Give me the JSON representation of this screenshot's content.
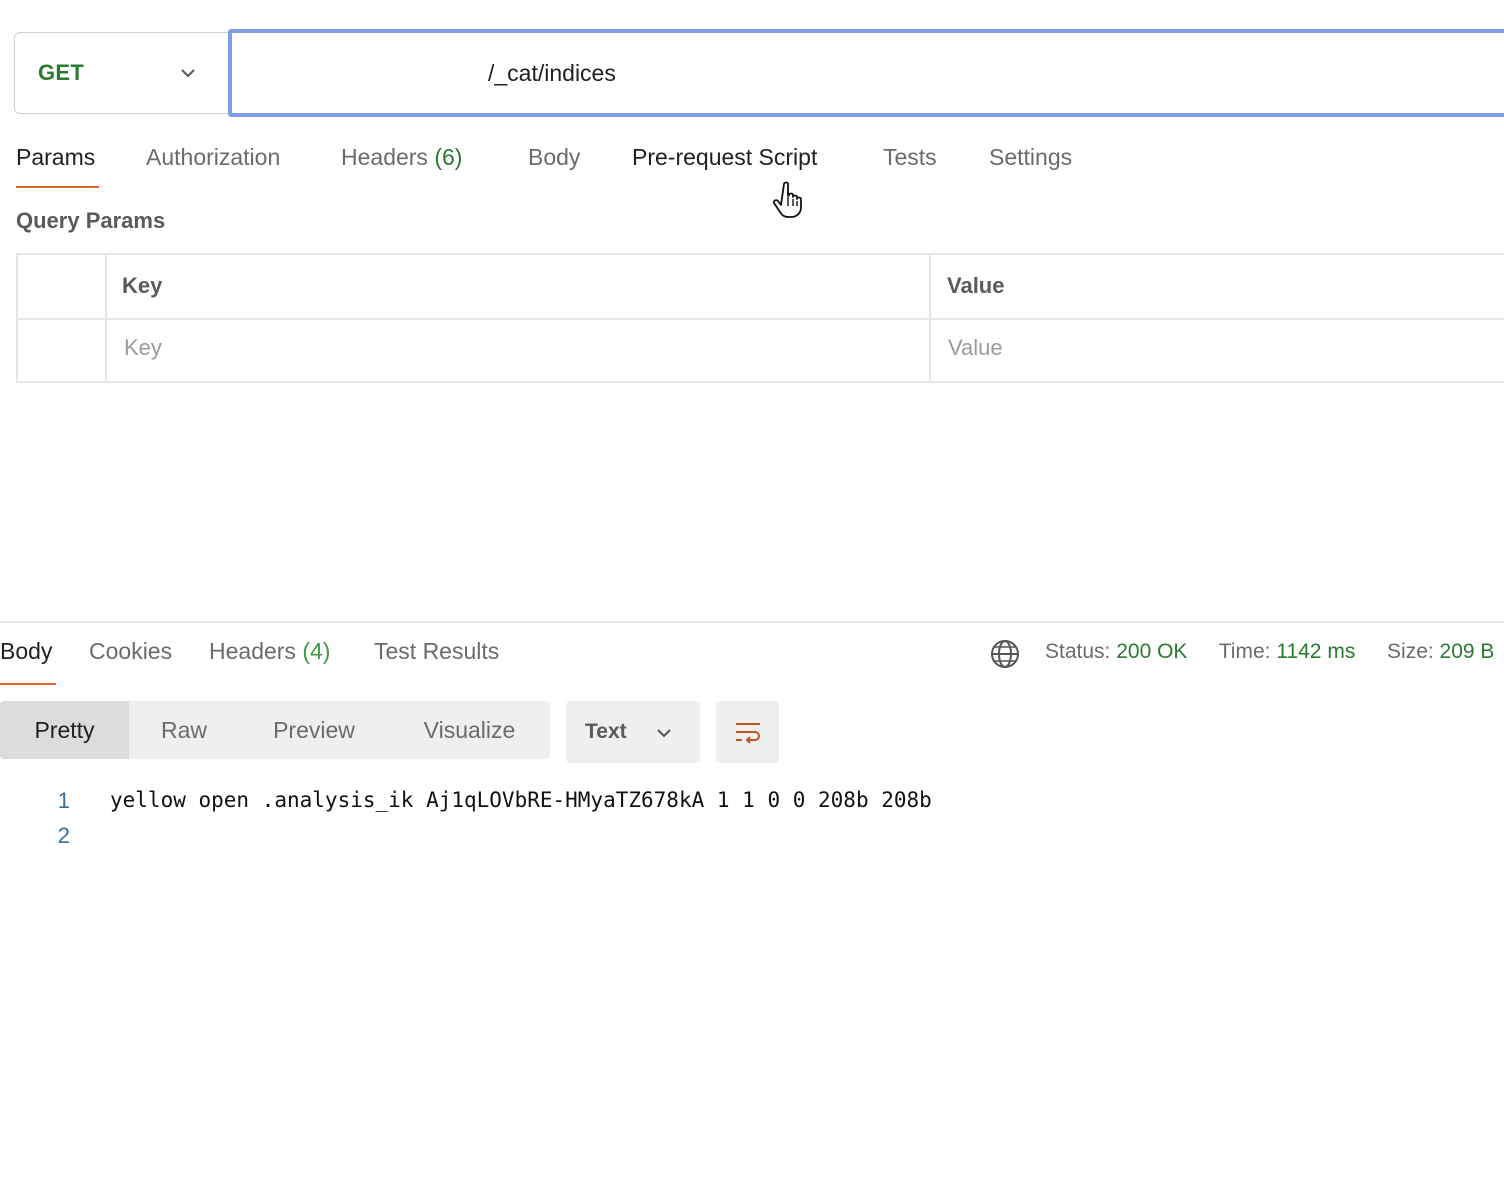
{
  "request": {
    "method": "GET",
    "url": "/_cat/indices"
  },
  "request_tabs": [
    {
      "label": "Params",
      "count": "",
      "active": true
    },
    {
      "label": "Authorization",
      "count": ""
    },
    {
      "label": "Headers",
      "count": "(6)"
    },
    {
      "label": "Body",
      "count": ""
    },
    {
      "label": "Pre-request Script",
      "count": ""
    },
    {
      "label": "Tests",
      "count": ""
    },
    {
      "label": "Settings",
      "count": ""
    }
  ],
  "query_params": {
    "title": "Query Params",
    "columns": [
      "Key",
      "Value"
    ],
    "placeholders": {
      "key": "Key",
      "value": "Value"
    }
  },
  "response": {
    "tabs": [
      {
        "label": "Body",
        "count": "",
        "active": true
      },
      {
        "label": "Cookies",
        "count": ""
      },
      {
        "label": "Headers",
        "count": "(4)"
      },
      {
        "label": "Test Results",
        "count": ""
      }
    ],
    "status_label": "Status:",
    "status_value": "200 OK",
    "time_label": "Time:",
    "time_value": "1142 ms",
    "size_label": "Size:",
    "size_value": "209 B",
    "view_modes": [
      "Pretty",
      "Raw",
      "Preview",
      "Visualize"
    ],
    "active_view_mode": "Pretty",
    "format": "Text",
    "lines": [
      {
        "no": "1",
        "text": "yellow open .analysis_ik Aj1qLOVbRE-HMyaTZ678kA 1 1 0 0 208b 208b"
      },
      {
        "no": "2",
        "text": ""
      }
    ]
  },
  "colors": {
    "accent": "#e0662e",
    "method_get": "#2b7a2f",
    "url_focus_border": "#7b9ee6",
    "status_ok": "#2b7a2f",
    "line_number": "#3b6e99"
  },
  "icons": {
    "method_chevron": "chevron-down-icon",
    "globe": "globe-icon",
    "format_chevron": "chevron-down-icon",
    "wrap": "wrap-lines-icon",
    "cursor": "hand-pointer-cursor-icon"
  }
}
